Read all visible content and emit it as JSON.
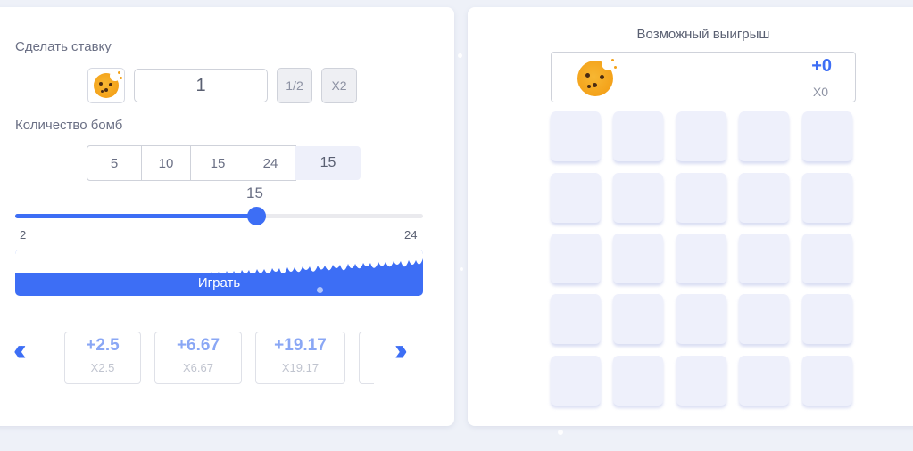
{
  "bet": {
    "label": "Сделать ставку",
    "currency_icon": "cookie-icon",
    "amount": "1",
    "half_label": "1/2",
    "double_label": "X2"
  },
  "bombs": {
    "label": "Количество бомб",
    "options": [
      "5",
      "10",
      "15",
      "24"
    ],
    "selected": "15"
  },
  "slider": {
    "value": "15",
    "min": "2",
    "max": "24",
    "fraction": 0.59
  },
  "play": {
    "label": "Играть"
  },
  "multipliers": {
    "prev_icon": "double-chevron-left-icon",
    "next_icon": "double-chevron-right-icon",
    "items": [
      {
        "amount": "+2.5",
        "x": "X2.5"
      },
      {
        "amount": "+6.67",
        "x": "X6.67"
      },
      {
        "amount": "+19.17",
        "x": "X19.17"
      }
    ]
  },
  "win": {
    "label": "Возможный выигрыш",
    "amount": "+0",
    "multiplier": "X0",
    "icon": "cookie-icon"
  },
  "colors": {
    "accent": "#3d6ef5",
    "tile": "#eef0fb",
    "background": "#eef1f8"
  }
}
